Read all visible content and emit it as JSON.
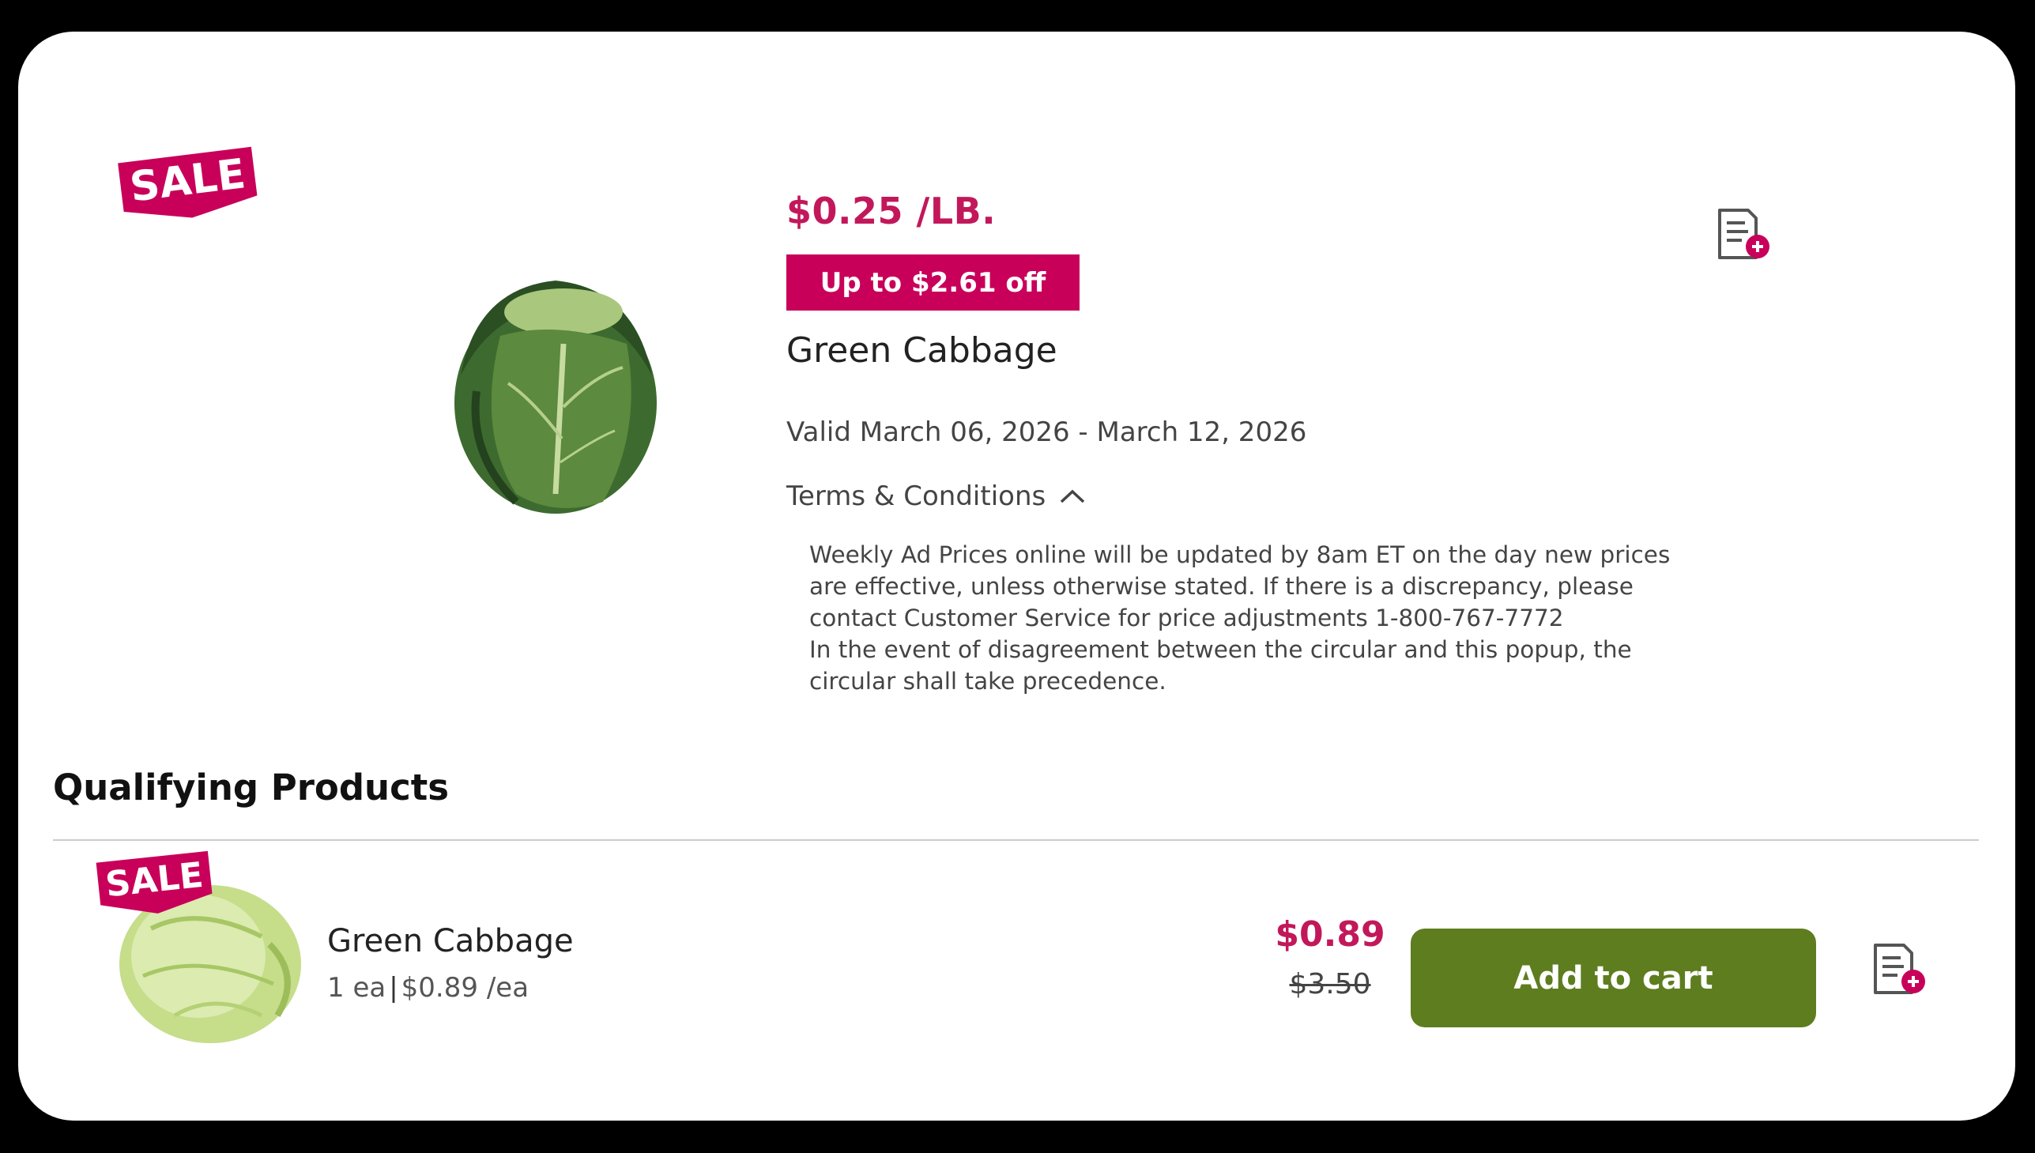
{
  "colors": {
    "accent": "#c2185b",
    "badge_bg": "#c8005a",
    "button_bg": "#5e7d1f"
  },
  "hero": {
    "sale_badge": "SALE",
    "price": "$0.25 /LB.",
    "discount_badge": "Up to $2.61 off",
    "title": "Green Cabbage",
    "valid": "Valid March 06, 2026 - March 12, 2026",
    "terms_label": "Terms & Conditions",
    "terms_lines": [
      "Weekly Ad Prices online will be updated by 8am ET on the day new prices",
      "are effective, unless otherwise stated. If there is a discrepancy, please",
      "contact Customer Service for price adjustments 1-800-767-7772",
      "In the event of disagreement between the circular and this popup, the",
      "circular shall take precedence."
    ],
    "list_icon": "add-to-list-icon"
  },
  "qualifying": {
    "heading": "Qualifying Products",
    "items": [
      {
        "sale_badge": "SALE",
        "name": "Green Cabbage",
        "quantity": "1 ea",
        "unit_price": "$0.89 /ea",
        "price": "$0.89",
        "original_price": "$3.50",
        "button_label": "Add to cart",
        "list_icon": "add-to-list-icon"
      }
    ]
  }
}
